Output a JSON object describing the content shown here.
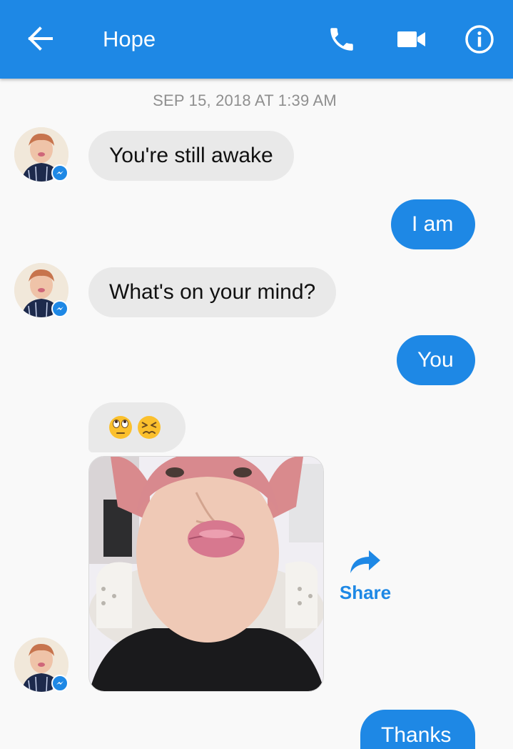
{
  "header": {
    "contact_name": "Hope",
    "icons": [
      "back-arrow-icon",
      "phone-icon",
      "video-camera-icon",
      "info-icon"
    ],
    "background_color": "#1e88e5"
  },
  "timestamp": "SEP 15, 2018 AT 1:39 AM",
  "messages": [
    {
      "direction": "incoming",
      "text": "You're still awake"
    },
    {
      "direction": "outgoing",
      "text": "I am"
    },
    {
      "direction": "incoming",
      "text": "What's on your mind?"
    },
    {
      "direction": "outgoing",
      "text": "You"
    },
    {
      "direction": "incoming",
      "type": "emoji",
      "emoji": [
        "eye-roll-emoji",
        "persevering-face-emoji"
      ]
    },
    {
      "direction": "incoming",
      "type": "photo",
      "description": "selfie photo"
    },
    {
      "direction": "outgoing",
      "text": "Thanks"
    }
  ],
  "share": {
    "label": "Share",
    "icon": "share-arrow-icon"
  },
  "colors": {
    "outgoing_bubble": "#1e88e5",
    "incoming_bubble": "#e9e9e9",
    "timestamp": "#8f8f8f",
    "background": "#f9f9f9"
  }
}
